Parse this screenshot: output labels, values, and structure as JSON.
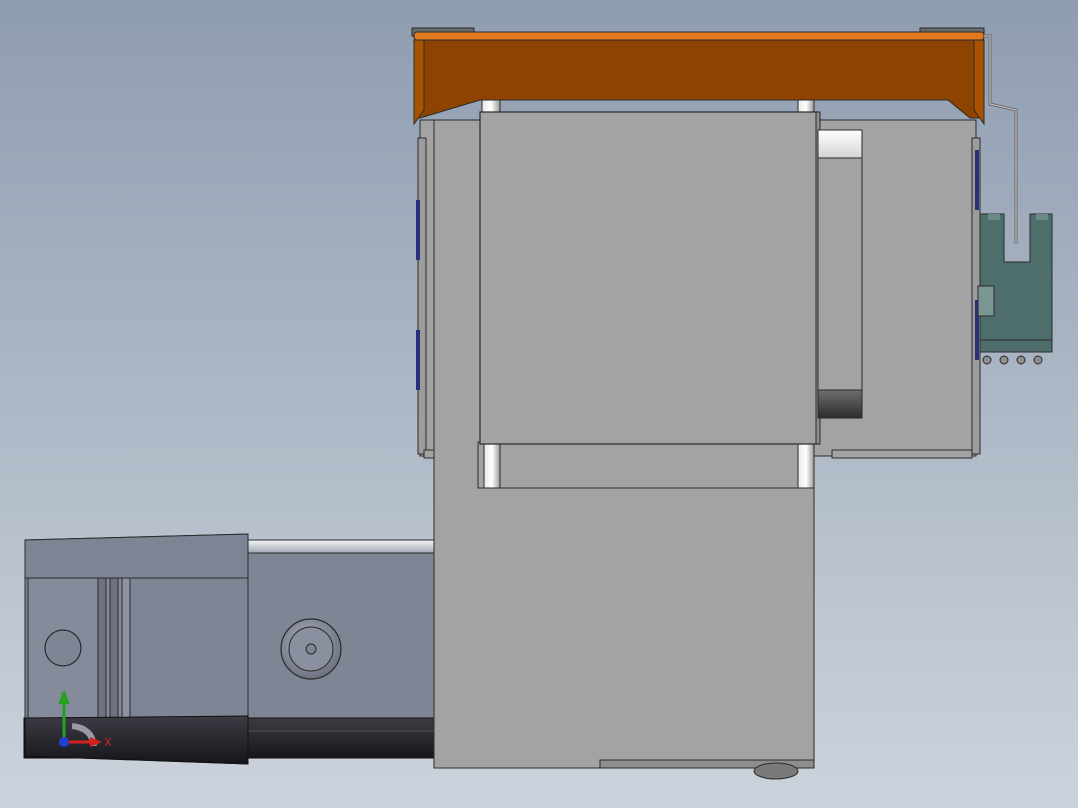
{
  "viewport": {
    "background_top": "#8f9db0",
    "background_bottom": "#ccd3dc"
  },
  "colors": {
    "orange_top": "#e07a1f",
    "orange_body": "#8f4300",
    "gray_part": "#a3a3a3",
    "gray_dark": "#8a8a8a",
    "slate_part": "#7e8595",
    "bracket_teal": "#4e6e6c",
    "edge": "#2b2b2b"
  },
  "triad": {
    "x_label": "X",
    "y_label": "Y",
    "x_color": "#d62020",
    "y_color": "#25a025",
    "z_color": "#2040d0"
  }
}
